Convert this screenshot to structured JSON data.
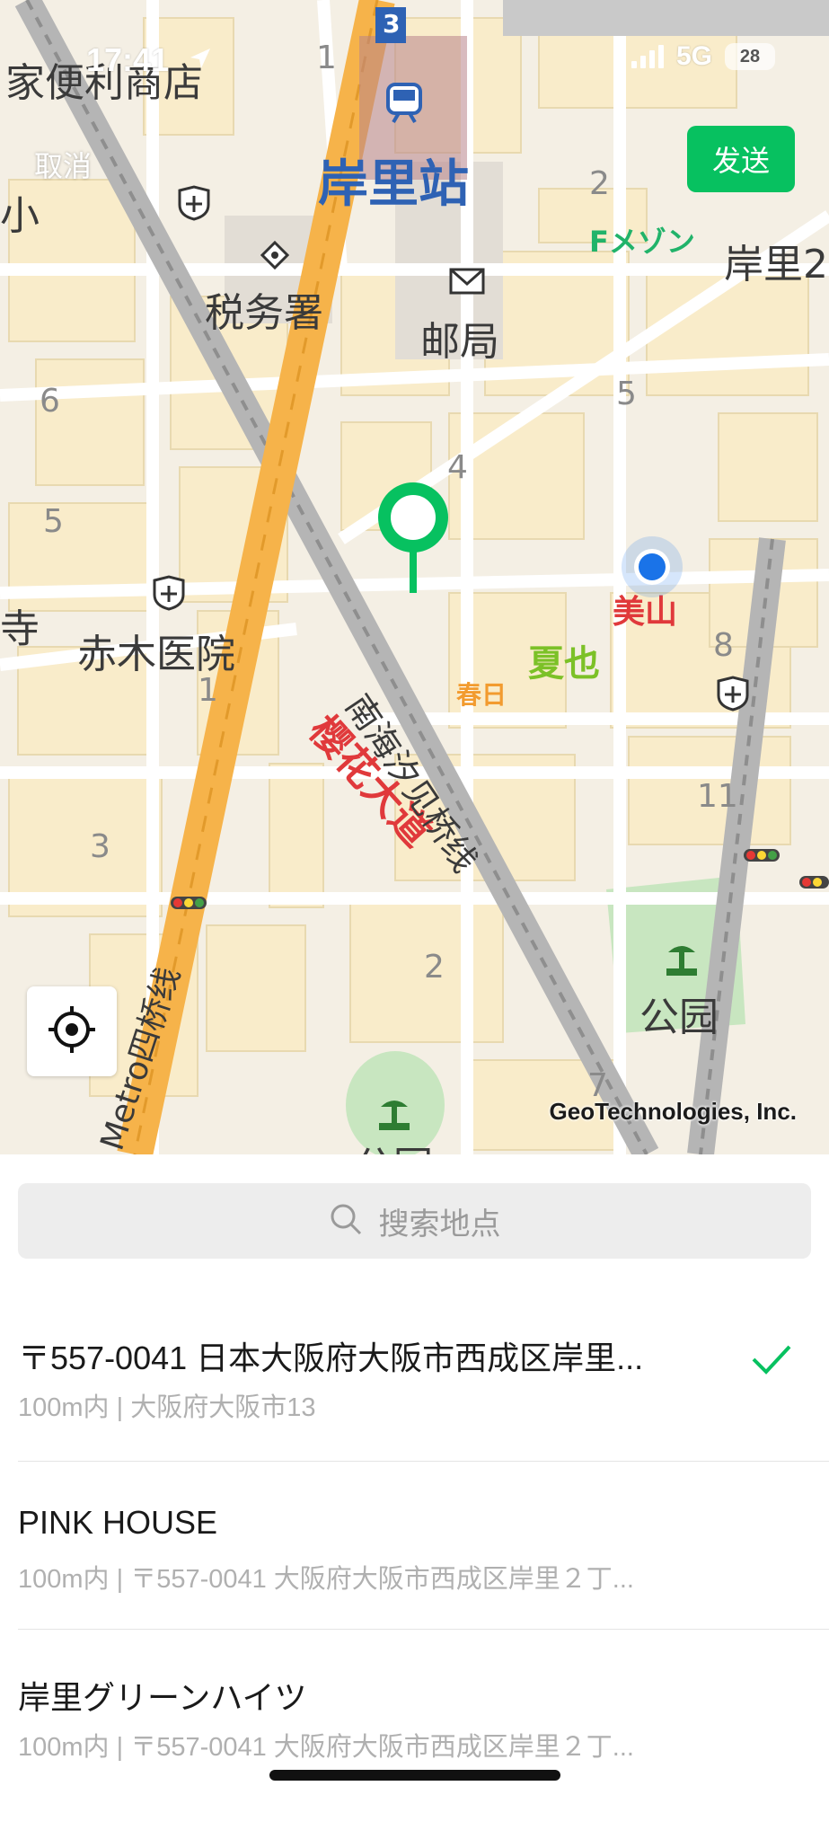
{
  "status_bar": {
    "time": "17:41",
    "network": "5G",
    "battery": "28"
  },
  "header": {
    "cancel_label": "取消",
    "send_label": "发送"
  },
  "map": {
    "labels": {
      "convenience_store": "家便利商店",
      "station": "岸里站",
      "station_number": "3",
      "tax_office": "税务署",
      "post_office": "邮局",
      "f_mezon": "Fメゾン",
      "kishiri_2": "岸里2",
      "small": "小",
      "temple": "寺",
      "clinic": "赤木医院",
      "miyama": "美山",
      "natsuya": "夏也",
      "kasuga": "春日",
      "sakura_ave": "樱花大道",
      "nankai_line": "南海汐见桥线",
      "metro_line": "Metro四桥线",
      "park_1": "公园",
      "park_2": "公园",
      "block_1a": "1",
      "block_2a": "2",
      "block_4": "4",
      "block_5a": "5",
      "block_5b": "5",
      "block_6": "6",
      "block_1b": "1",
      "block_3": "3",
      "block_8": "8",
      "block_11": "11",
      "block_2b": "2",
      "block_7": "7"
    },
    "credit": "GeoTechnologies, Inc.",
    "colors": {
      "background": "#f4efe4",
      "building": "#f9ecca",
      "road": "#ffffff",
      "major_road": "#f6b34a",
      "rail": "#b5b5b5",
      "park": "#c8e6c0",
      "pin": "#07c160",
      "current_location": "#1a73e8"
    }
  },
  "search": {
    "placeholder": "搜索地点"
  },
  "results": [
    {
      "title": "〒557-0041 日本大阪府大阪市西成区岸里...",
      "subtitle": "100m内 | 大阪府大阪市13",
      "selected": true
    },
    {
      "title": "PINK HOUSE",
      "subtitle": "100m内 | 〒557-0041 大阪府大阪市西成区岸里２丁...",
      "selected": false
    },
    {
      "title": "岸里グリーンハイツ",
      "subtitle": "100m内 | 〒557-0041 大阪府大阪市西成区岸里２丁...",
      "selected": false
    }
  ],
  "icons": {
    "search": "search-icon",
    "locate": "crosshair-icon",
    "check": "check-icon",
    "pin": "location-pin-icon"
  }
}
